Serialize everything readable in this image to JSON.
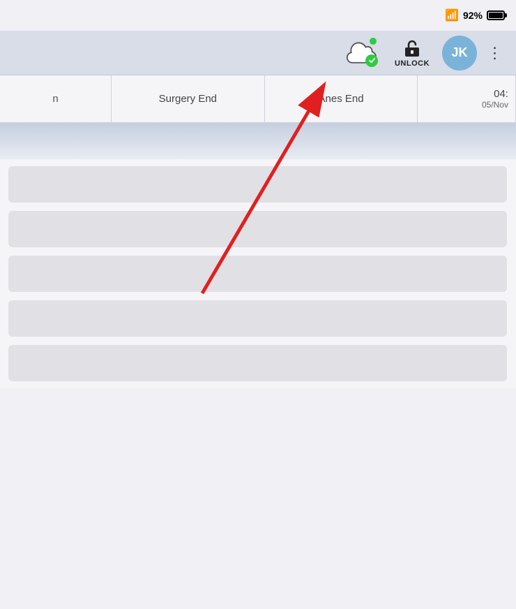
{
  "status_bar": {
    "wifi_icon": "wifi",
    "battery_percent": "92%",
    "battery_level": 92
  },
  "toolbar": {
    "cloud_sync_status": "synced",
    "online_dot_color": "#2ecc40",
    "unlock_label": "UNLOCK",
    "avatar_initials": "JK",
    "avatar_bg": "#7ab3d8",
    "more_icon": "⋮"
  },
  "columns": [
    {
      "id": "left-partial",
      "label": "n",
      "sub": ""
    },
    {
      "id": "surgery-end",
      "label": "Surgery End",
      "sub": ""
    },
    {
      "id": "anes-end",
      "label": "Anes End",
      "sub": ""
    },
    {
      "id": "time",
      "label": "04:",
      "sub": "05/Nov"
    }
  ],
  "rows": [
    {
      "id": 1
    },
    {
      "id": 2
    },
    {
      "id": 3
    },
    {
      "id": 4
    },
    {
      "id": 5
    }
  ]
}
